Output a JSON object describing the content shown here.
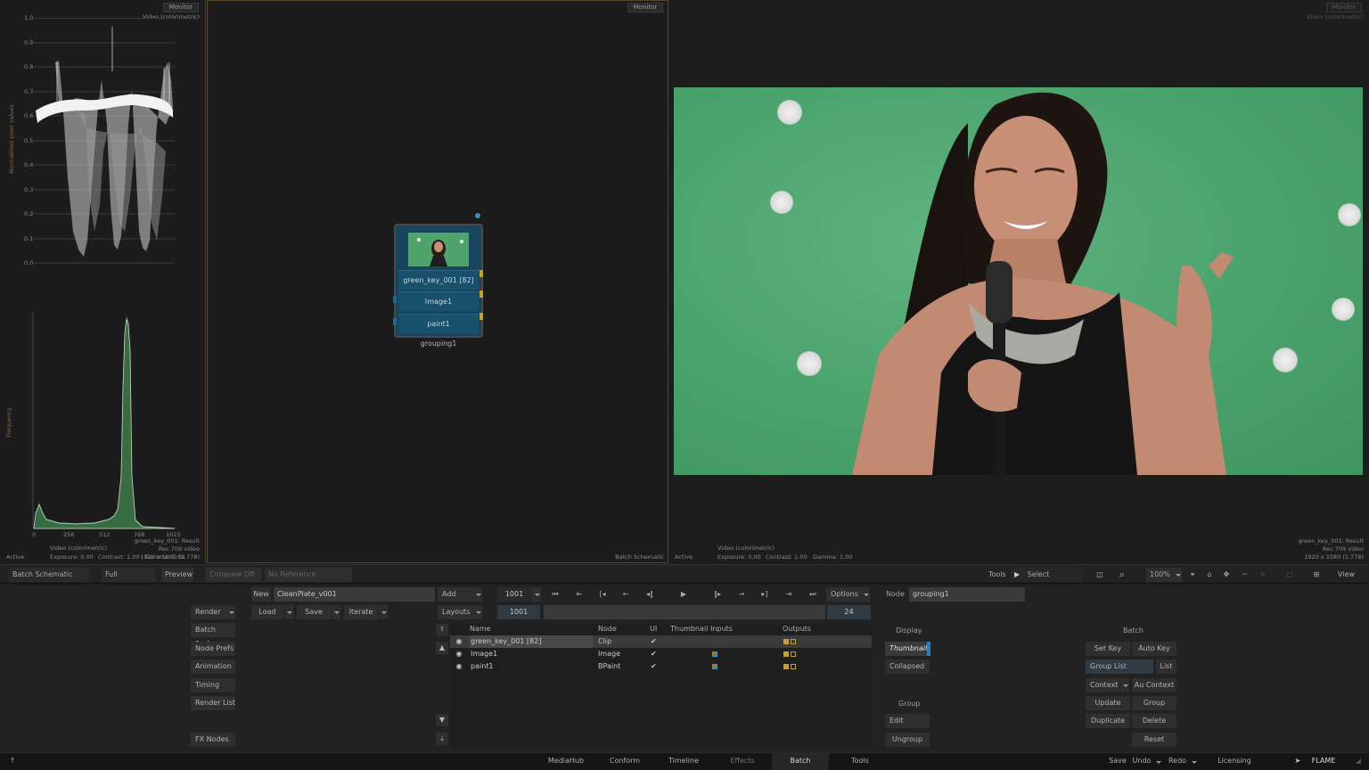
{
  "scope": {
    "waveform": {
      "monitor_label": "Monitor",
      "mode": "Video (colorimetric)",
      "y_axis_label": "Normalized pixel values",
      "ticks": [
        "1.0",
        "0.9",
        "0.8",
        "0.7",
        "0.6",
        "0.5",
        "0.4",
        "0.3",
        "0.2",
        "0.1",
        "0.0"
      ]
    },
    "histogram": {
      "y_axis_label": "Frequency",
      "x_ticks": [
        "0",
        "256",
        "512",
        "768",
        "1023"
      ],
      "mode": "Video (colorimetric)",
      "source": "green_key_001: Result",
      "colorspace": "Rec.709 video",
      "resolution": "1920 x 1080 (1.778)",
      "status": "Active",
      "exposure": "Exposure: 0.00",
      "contrast": "Contrast: 1.00",
      "gamma": "Gamma: 1.00"
    }
  },
  "schematic": {
    "monitor_label": "Monitor",
    "panel_label": "Batch Schematic",
    "node": {
      "rows": [
        "green_key_001 [82]",
        "Image1",
        "paint1"
      ],
      "name": "grouping1"
    }
  },
  "viewer": {
    "monitor_label": "Monitor",
    "mode_top": "Video (colorimetric)",
    "mode": "Video (colorimetric)",
    "status": "Active",
    "exposure": "Exposure: 0.00",
    "contrast": "Contrast: 1.00",
    "gamma": "Gamma: 1.00",
    "source": "green_key_001: Result",
    "colorspace": "Rec.709 video",
    "resolution": "1920 x 1080 (1.778)"
  },
  "strip": {
    "batch_schematic": "Batch Schematic",
    "full_resolution": "Full Resolution",
    "preview": "Preview",
    "compare_off": "Compare Off",
    "no_reference": "No Reference",
    "tools": "Tools",
    "select": "Select",
    "zoom": "100%",
    "view": "View"
  },
  "bottom": {
    "left_buttons": [
      "Render",
      "Batch Prefs",
      "Node Prefs",
      "Animation",
      "Timing",
      "Render List",
      "FX Nodes"
    ],
    "new_label": "New",
    "setup_name": "CleanPlate_v001",
    "load": "Load",
    "save": "Save",
    "iterate": "Iterate",
    "add_token": "Add Token",
    "layouts": "Layouts",
    "frame": "1001",
    "start_frame": "1001",
    "end_frame": "24",
    "options": "Options",
    "table": {
      "headers": [
        "Name",
        "Node",
        "UI",
        "Thumbnail",
        "Inputs",
        "Outputs"
      ],
      "rows": [
        {
          "name": "green_key_001 [82]",
          "node": "Clip",
          "ui": "✔"
        },
        {
          "name": "Image1",
          "node": "Image",
          "ui": "✔"
        },
        {
          "name": "paint1",
          "node": "BPaint",
          "ui": "✔"
        }
      ]
    },
    "node_label": "Node",
    "node_name": "grouping1",
    "display_label": "Display",
    "thumbnail": "Thumbnail",
    "collapsed": "Collapsed",
    "group_label": "Group",
    "edit": "Edit",
    "ungroup": "Ungroup",
    "batch_label": "Batch",
    "set_key": "Set Key",
    "auto_key": "Auto Key",
    "group_list": "Group List",
    "list": "List",
    "context": "Context",
    "au_context": "Au Context",
    "update": "Update",
    "group": "Group",
    "duplicate": "Duplicate",
    "delete": "Delete",
    "reset": "Reset"
  },
  "tabs": [
    "MediaHub",
    "Conform",
    "Timeline",
    "Effects",
    "Batch",
    "Tools"
  ],
  "footer": {
    "save": "Save",
    "undo": "Undo",
    "redo": "Redo",
    "licensing": "Licensing",
    "brand": "FLAME"
  }
}
